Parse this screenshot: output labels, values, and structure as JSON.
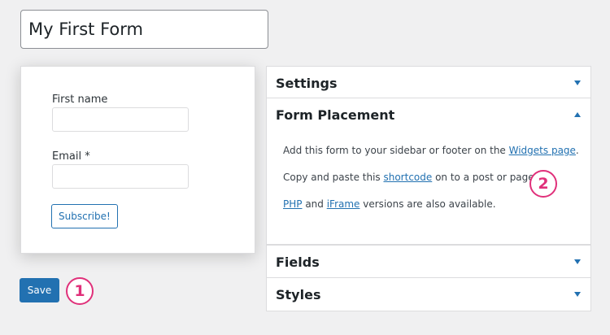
{
  "form": {
    "title": "My First Form"
  },
  "preview": {
    "first_name_label": "First name",
    "email_label": "Email *",
    "subscribe_label": "Subscribe!"
  },
  "actions": {
    "save_label": "Save"
  },
  "badges": {
    "step1": "1",
    "step2": "2"
  },
  "panels": {
    "settings": {
      "title": "Settings",
      "state": "collapsed"
    },
    "placement": {
      "title": "Form Placement",
      "state": "expanded",
      "line1_text": "Add this form to your sidebar or footer on the ",
      "line1_link": "Widgets page",
      "line1_end": ".",
      "line2_text": "Copy and paste this ",
      "line2_link": "shortcode",
      "line2_end": " on to a post or page.",
      "line3_link1": "PHP",
      "line3_mid": " and ",
      "line3_link2": "iFrame",
      "line3_end": " versions are also available."
    },
    "fields": {
      "title": "Fields",
      "state": "collapsed"
    },
    "styles": {
      "title": "Styles",
      "state": "collapsed"
    }
  },
  "colors": {
    "accent": "#2271b1",
    "badge": "#e0307a",
    "background": "#f0f0f1"
  }
}
